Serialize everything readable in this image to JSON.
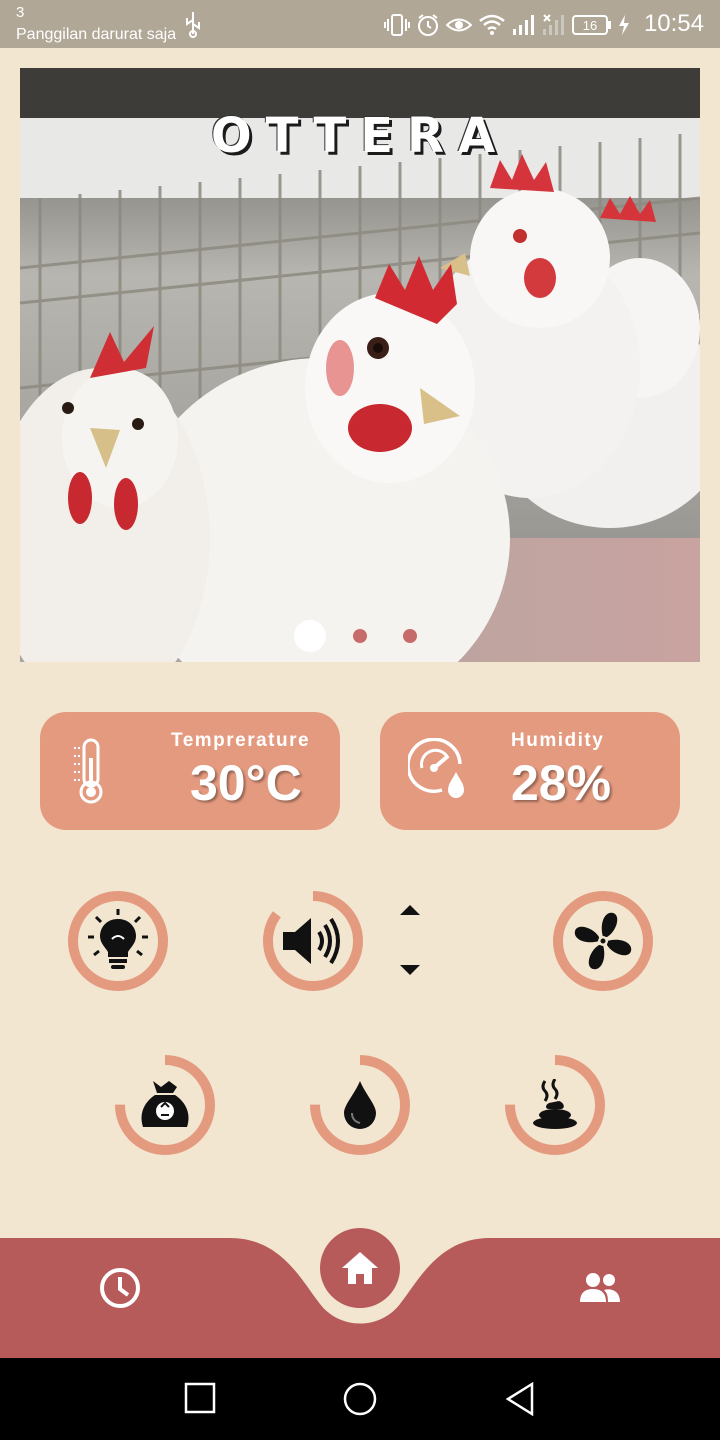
{
  "status_bar": {
    "notification_count": "3",
    "carrier": "Panggilan darurat saja",
    "battery": "16",
    "time": "10:54",
    "icons": [
      "usb-icon",
      "vibrate-icon",
      "alarm-icon",
      "eye-icon",
      "wifi-icon",
      "signal-icon",
      "signal-off-icon",
      "battery-icon",
      "charging-icon"
    ]
  },
  "hero": {
    "title": "OTTERA",
    "carousel": {
      "active_index": 0,
      "count": 3
    }
  },
  "sensors": {
    "temperature": {
      "label": "Temprerature",
      "value": "30°C",
      "icon": "thermometer-icon"
    },
    "humidity": {
      "label": "Humidity",
      "value": "28%",
      "icon": "gauge-droplet-icon"
    }
  },
  "controls": [
    {
      "name": "light",
      "icon": "lightbulb-icon",
      "level": 1.0
    },
    {
      "name": "speaker",
      "icon": "speaker-icon",
      "level": 0.85
    },
    {
      "name": "fan",
      "icon": "fan-icon",
      "level": 1.0
    },
    {
      "name": "feed",
      "icon": "feed-bag-icon",
      "level": 0.75
    },
    {
      "name": "water",
      "icon": "water-drop-icon",
      "level": 0.75
    },
    {
      "name": "manure",
      "icon": "manure-icon",
      "level": 0.75
    }
  ],
  "bottom_nav": [
    "history-icon",
    "home-icon",
    "users-icon"
  ],
  "colors": {
    "background": "#f2e6d0",
    "accent": "#e49a7f",
    "nav": "#b75a5a",
    "dot_inactive": "#c76a6a"
  }
}
